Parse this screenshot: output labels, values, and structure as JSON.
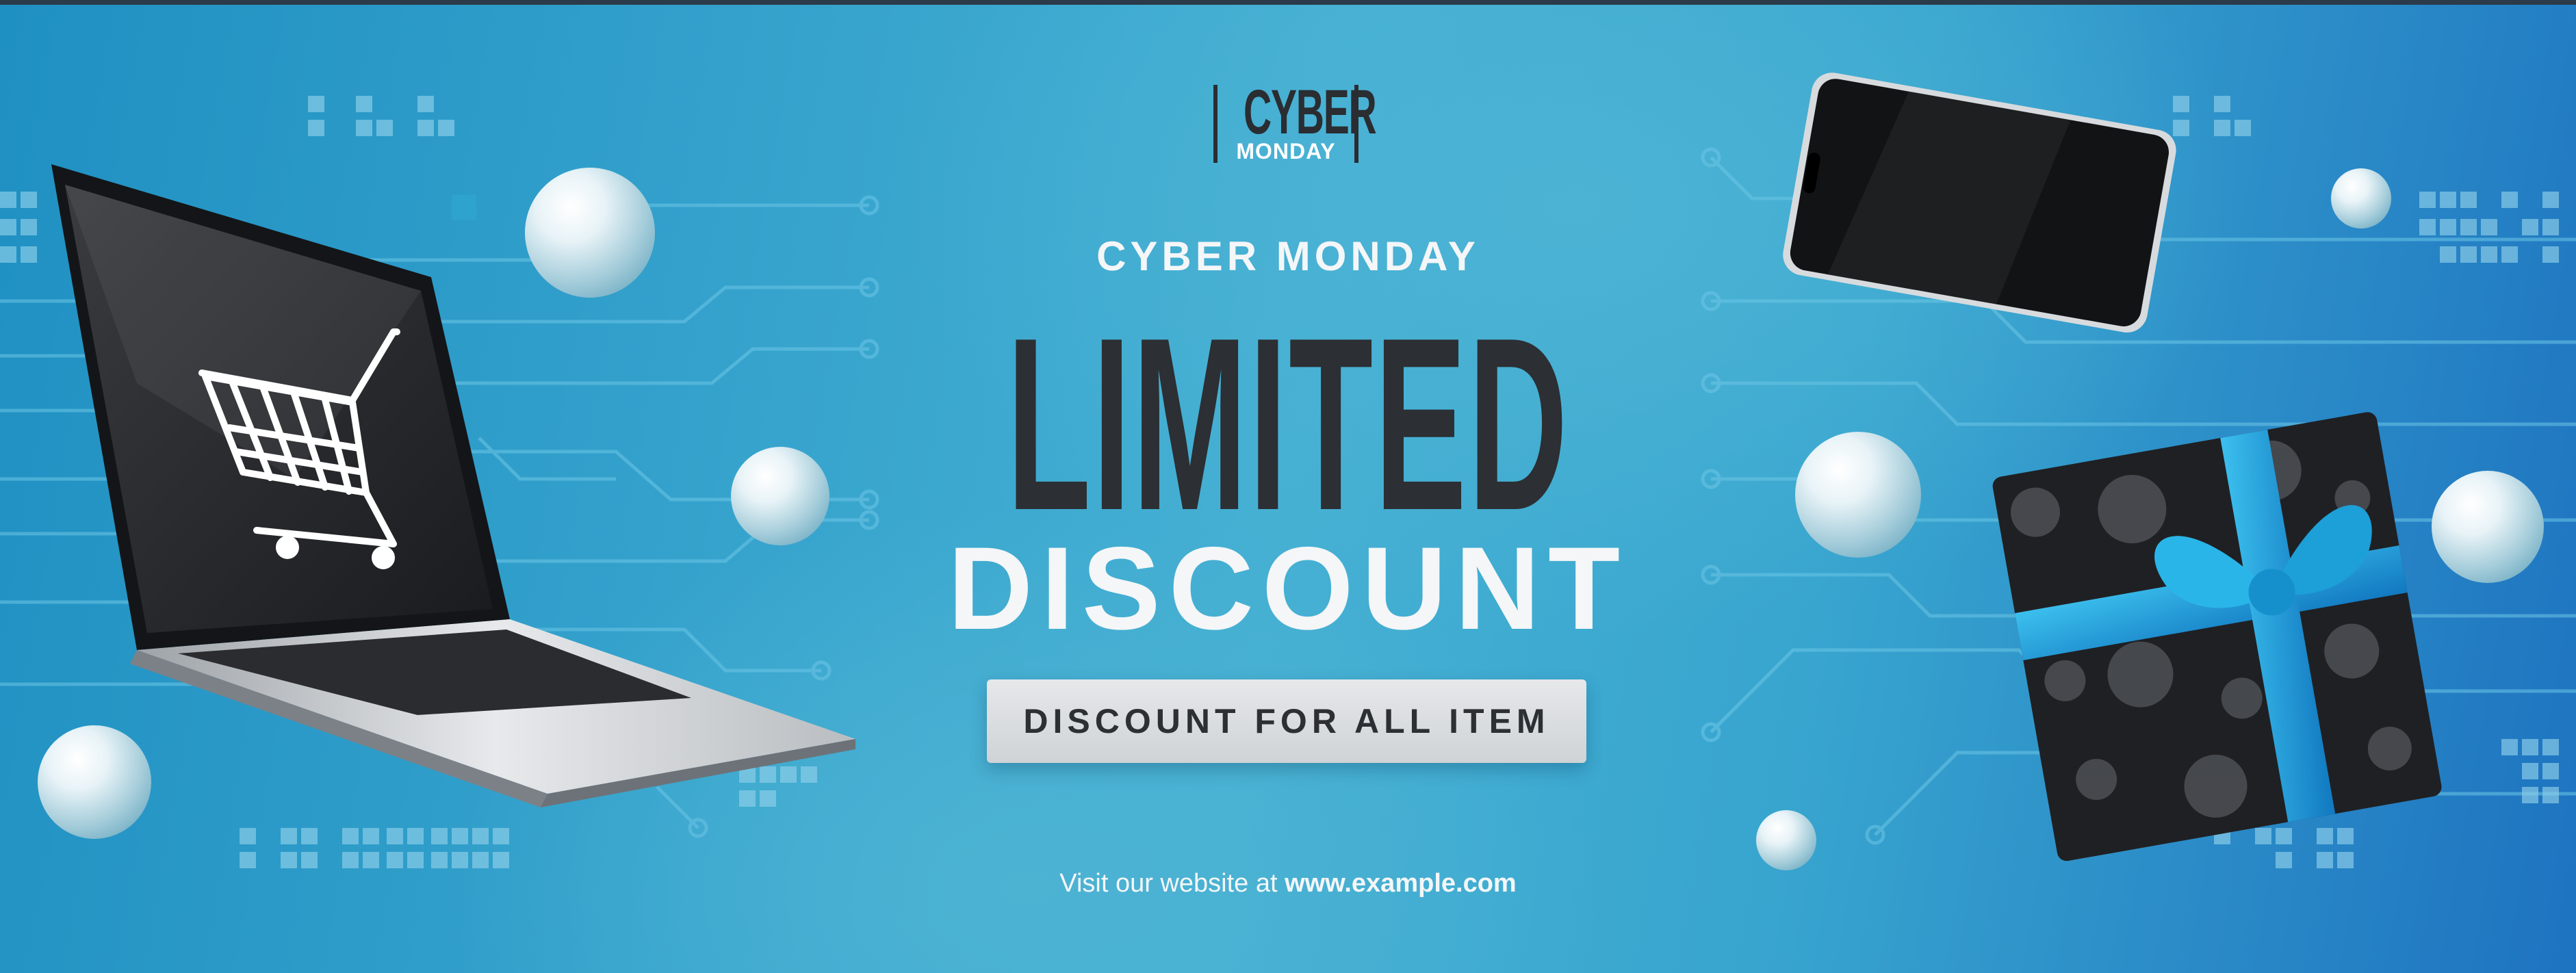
{
  "logo": {
    "top": "CYBER",
    "bottom": "MONDAY"
  },
  "kicker": "CYBER MONDAY",
  "headline": "LIMITED",
  "subhead": "DISCOUNT",
  "cta_label": "DISCOUNT FOR ALL ITEM",
  "footer": {
    "prefix": "Visit our website at ",
    "url": "www.example.com"
  },
  "colors": {
    "background_blue": "#36a3cd",
    "dark_text": "#2c2f33",
    "light_text": "#f4f6f8",
    "ribbon_blue": "#1fa6dc",
    "device_dark": "#1c1e21"
  },
  "icons": [
    "laptop-icon",
    "shopping-cart-icon",
    "smartphone-icon",
    "gift-box-icon",
    "pearl-ball-icon",
    "circuit-lines"
  ]
}
